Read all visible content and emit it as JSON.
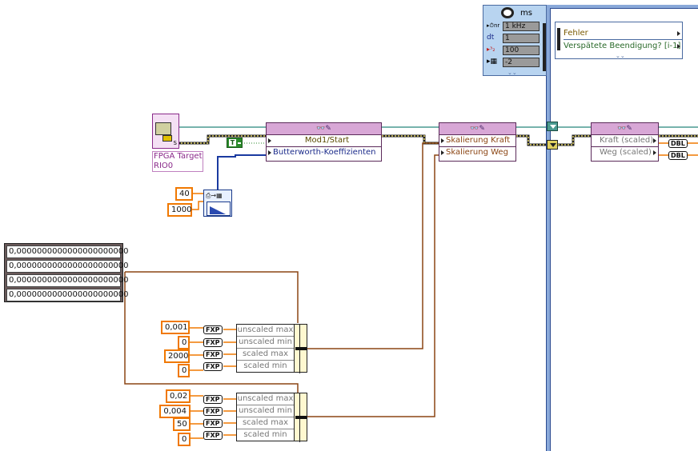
{
  "timing": {
    "unit": "ms",
    "rows": [
      {
        "label": "",
        "value": "1 kHz",
        "icon": "clock-source-icon"
      },
      {
        "label": "dt",
        "value": "1"
      },
      {
        "label": "",
        "value": "100",
        "icon": "offset-icon"
      },
      {
        "label": "",
        "value": "-2",
        "icon": "chip-icon"
      }
    ]
  },
  "error_node": {
    "rows": [
      "Fehler",
      "Verspätete Beendigung? [i-1]"
    ]
  },
  "fpga": {
    "label": "FPGA Target\nRIO0",
    "icon": "fpga-target-icon"
  },
  "bool_const": "T",
  "node1": {
    "rows": [
      "Mod1/Start",
      "Butterworth-Koeffizienten"
    ]
  },
  "node2": {
    "rows": [
      "Skalierung Kraft",
      "Skalierung Weg"
    ]
  },
  "node3": {
    "rows": [
      "Kraft (scaled)",
      "Weg (scaled)"
    ]
  },
  "dbl_label": "DBL",
  "fxp_label": "FXP",
  "filter_consts": [
    "40",
    "1000"
  ],
  "array": [
    "0,0000000000000000000000",
    "0,0000000000000000000000",
    "0,0000000000000000000000",
    "0,0000000000000000000000"
  ],
  "bundle1": {
    "consts": [
      "0,001",
      "0",
      "2000",
      "0"
    ],
    "rows": [
      "unscaled max",
      "unscaled min",
      "scaled max",
      "scaled min"
    ]
  },
  "bundle2": {
    "consts": [
      "0,02",
      "0,004",
      "50",
      "0"
    ],
    "rows": [
      "unscaled max",
      "unscaled min",
      "scaled max",
      "scaled min"
    ]
  },
  "colors": {
    "timed_loop_border": "#8aa9d9",
    "wire_orange": "#f07800",
    "wire_brown": "#8b4513",
    "wire_teal": "#4a9a90",
    "node_header": "#d8a7d6"
  }
}
